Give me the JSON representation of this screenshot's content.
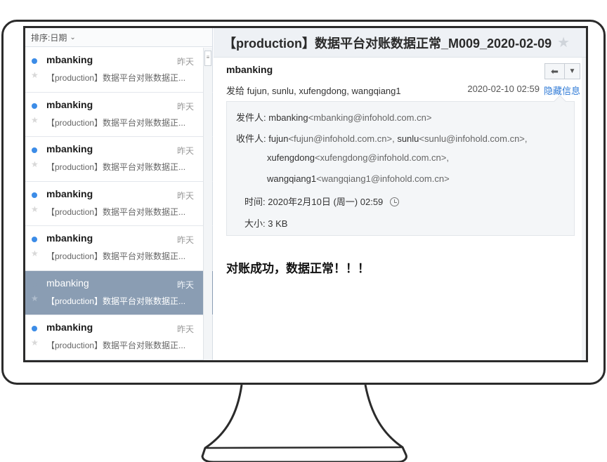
{
  "sort": {
    "label": "排序:日期",
    "chevron": "⌄"
  },
  "mail_list": [
    {
      "sender": "mbanking",
      "date": "昨天",
      "subject": "【production】数据平台对账数据正...",
      "selected": false
    },
    {
      "sender": "mbanking",
      "date": "昨天",
      "subject": "【production】数据平台对账数据正...",
      "selected": false
    },
    {
      "sender": "mbanking",
      "date": "昨天",
      "subject": "【production】数据平台对账数据正...",
      "selected": false
    },
    {
      "sender": "mbanking",
      "date": "昨天",
      "subject": "【production】数据平台对账数据正...",
      "selected": false
    },
    {
      "sender": "mbanking",
      "date": "昨天",
      "subject": "【production】数据平台对账数据正...",
      "selected": false
    },
    {
      "sender": "mbanking",
      "date": "昨天",
      "subject": "【production】数据平台对账数据正...",
      "selected": true
    },
    {
      "sender": "mbanking",
      "date": "昨天",
      "subject": "【production】数据平台对账数据正...",
      "selected": false
    }
  ],
  "scroll_glyph": "≡",
  "reader": {
    "title": "【production】数据平台对账数据正常_M009_2020-02-09",
    "from_name": "mbanking",
    "to_line": "发给 fujun, sunlu, xufengdong, wangqiang1",
    "sent_time": "2020-02-10 02:59",
    "hide_link": "隐藏信息",
    "reply_glyph": "⬅",
    "more_glyph": "▼",
    "detail": {
      "from_label": "发件人:",
      "from_name": "mbanking",
      "from_addr": "<mbanking@infohold.com.cn>",
      "to_label": "收件人:",
      "to_1_name": "fujun",
      "to_1_addr": "<fujun@infohold.com.cn>,",
      "to_2_name": "sunlu",
      "to_2_addr": "<sunlu@infohold.com.cn>,",
      "to_3_name": "xufengdong",
      "to_3_addr": "<xufengdong@infohold.com.cn>,",
      "to_4_name": "wangqiang1",
      "to_4_addr": "<wangqiang1@infohold.com.cn>",
      "time_label": "时间:",
      "time_value": "2020年2月10日 (周一) 02:59",
      "size_label": "大小:",
      "size_value": "3 KB"
    },
    "body": "对账成功，数据正常！！！"
  },
  "colors": {
    "accent": "#2f7ad6",
    "unread_dot": "#3c8ce7",
    "selected_row": "#8a9db3"
  }
}
